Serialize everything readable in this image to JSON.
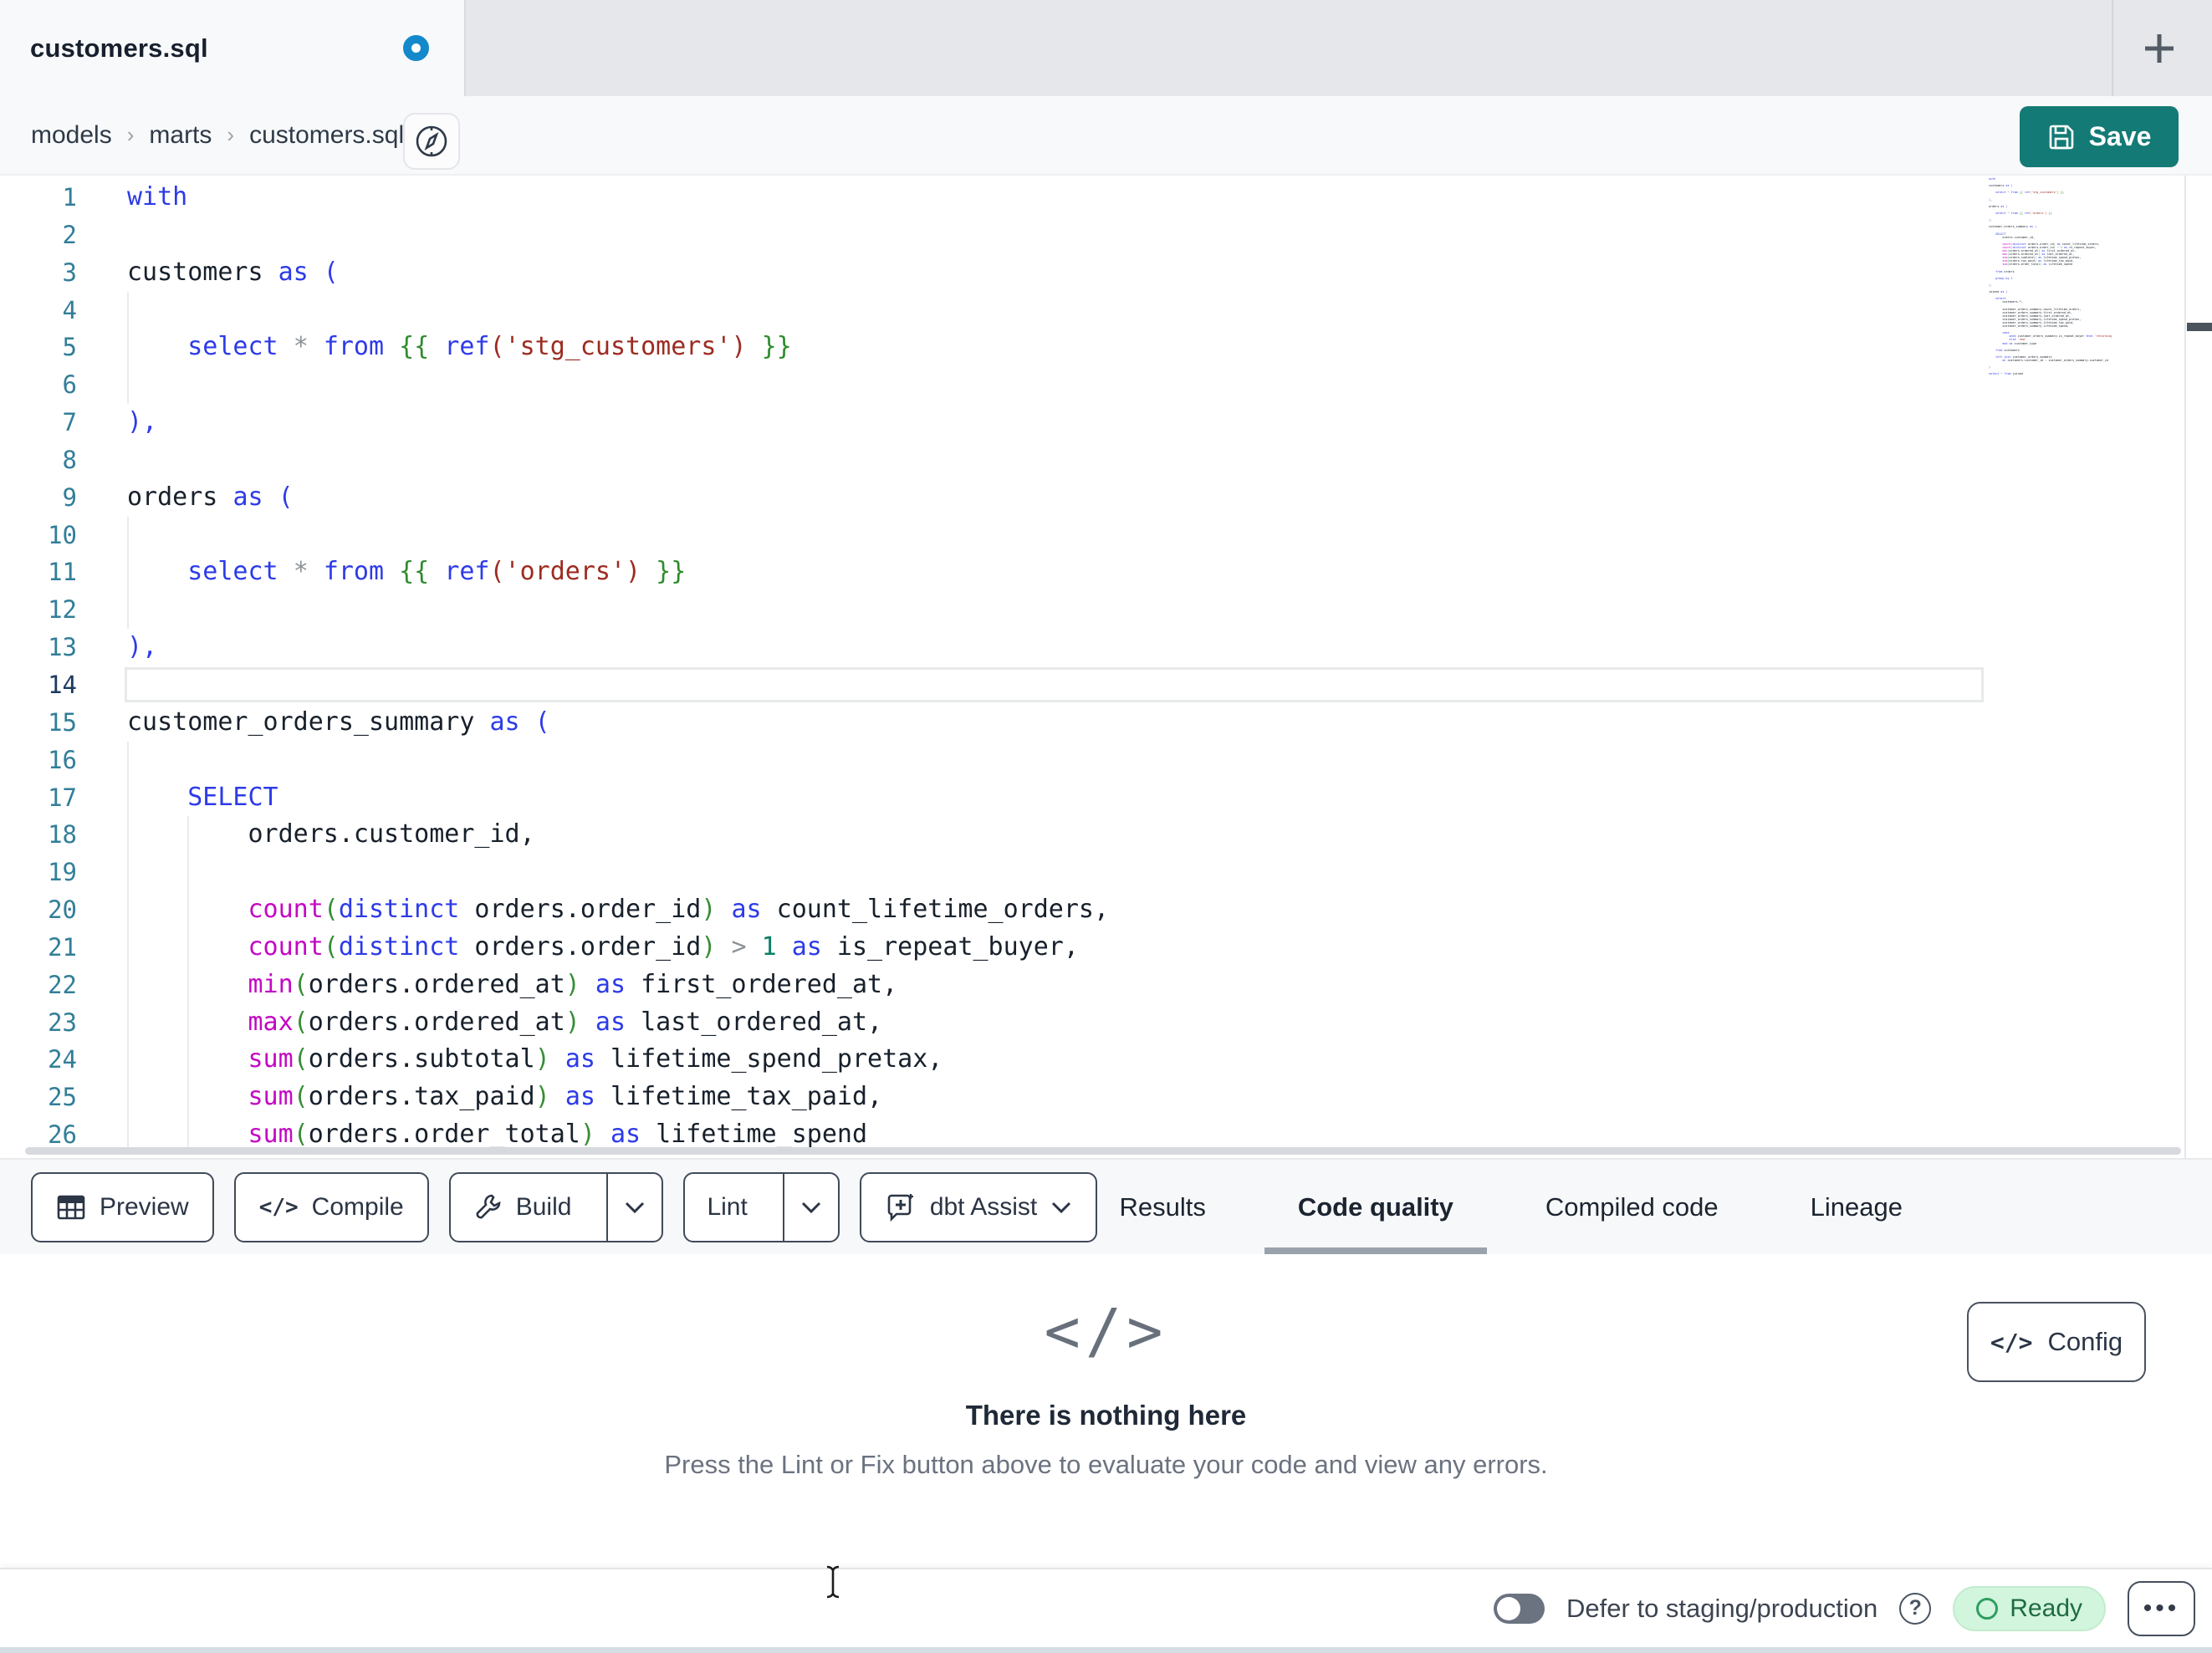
{
  "window": {
    "active_tab_title": "customers.sql",
    "has_unsaved_changes": true
  },
  "breadcrumb": {
    "items": [
      "models",
      "marts",
      "customers.sql"
    ],
    "separator": "›"
  },
  "header": {
    "save_label": "Save"
  },
  "icons": {
    "plus": "+",
    "help": "?",
    "ellipsis": "•••",
    "compile_glyph": "</>",
    "config_glyph": "</>",
    "empty_state_glyph": "</>"
  },
  "colors": {
    "accent_teal": "#147a76",
    "unsaved_dot_blue": "#1389cb",
    "tabbar_gray": "#e5e7ea",
    "active_tab_underline": "#9aa2ac",
    "ready_bg": "#d2f5dd",
    "ready_green": "#2f9e5f",
    "token_kw": "#2d3be8",
    "token_fn": "#c408c4",
    "token_str": "#9c2b20",
    "token_jinja": "#2f8b2f",
    "token_paren": "#368d36",
    "token_num": "#0c7f68",
    "token_op": "#8b9299",
    "token_txt": "#17202b"
  },
  "editor": {
    "active_line": 14,
    "guides": {
      "4": [
        0
      ],
      "5": [
        0
      ],
      "6": [
        0
      ],
      "10": [
        0
      ],
      "11": [
        0
      ],
      "12": [
        0
      ],
      "16": [
        0
      ],
      "17": [
        0
      ],
      "18": [
        0,
        4
      ],
      "19": [
        0,
        4
      ],
      "20": [
        0,
        4
      ],
      "21": [
        0,
        4
      ],
      "22": [
        0,
        4
      ],
      "23": [
        0,
        4
      ],
      "24": [
        0,
        4
      ],
      "25": [
        0,
        4
      ],
      "26": [
        0,
        4
      ]
    },
    "lines": [
      {
        "n": 1,
        "tokens": [
          [
            "kw",
            "with"
          ]
        ]
      },
      {
        "n": 2,
        "tokens": []
      },
      {
        "n": 3,
        "tokens": [
          [
            "txt",
            "customers "
          ],
          [
            "kw",
            "as ("
          ]
        ]
      },
      {
        "n": 4,
        "tokens": []
      },
      {
        "n": 5,
        "tokens": [
          [
            "txt",
            "    "
          ],
          [
            "kw",
            "select"
          ],
          [
            "txt",
            " "
          ],
          [
            "op",
            "*"
          ],
          [
            "txt",
            " "
          ],
          [
            "kw",
            "from"
          ],
          [
            "txt",
            " "
          ],
          [
            "jinja",
            "{{ "
          ],
          [
            "kw",
            "ref"
          ],
          [
            "str",
            "('stg_customers')"
          ],
          [
            "jinja",
            " }}"
          ]
        ]
      },
      {
        "n": 6,
        "tokens": []
      },
      {
        "n": 7,
        "tokens": [
          [
            "kw",
            "),"
          ]
        ]
      },
      {
        "n": 8,
        "tokens": []
      },
      {
        "n": 9,
        "tokens": [
          [
            "txt",
            "orders "
          ],
          [
            "kw",
            "as ("
          ]
        ]
      },
      {
        "n": 10,
        "tokens": []
      },
      {
        "n": 11,
        "tokens": [
          [
            "txt",
            "    "
          ],
          [
            "kw",
            "select"
          ],
          [
            "txt",
            " "
          ],
          [
            "op",
            "*"
          ],
          [
            "txt",
            " "
          ],
          [
            "kw",
            "from"
          ],
          [
            "txt",
            " "
          ],
          [
            "jinja",
            "{{ "
          ],
          [
            "kw",
            "ref"
          ],
          [
            "str",
            "('orders')"
          ],
          [
            "jinja",
            " }}"
          ]
        ]
      },
      {
        "n": 12,
        "tokens": []
      },
      {
        "n": 13,
        "tokens": [
          [
            "kw",
            "),"
          ]
        ]
      },
      {
        "n": 14,
        "tokens": []
      },
      {
        "n": 15,
        "tokens": [
          [
            "txt",
            "customer_orders_summary "
          ],
          [
            "kw",
            "as ("
          ]
        ]
      },
      {
        "n": 16,
        "tokens": []
      },
      {
        "n": 17,
        "tokens": [
          [
            "txt",
            "    "
          ],
          [
            "kw",
            "SELECT"
          ]
        ]
      },
      {
        "n": 18,
        "tokens": [
          [
            "txt",
            "        orders.customer_id,"
          ]
        ]
      },
      {
        "n": 19,
        "tokens": []
      },
      {
        "n": 20,
        "tokens": [
          [
            "txt",
            "        "
          ],
          [
            "fn",
            "count"
          ],
          [
            "paren",
            "("
          ],
          [
            "kw",
            "distinct"
          ],
          [
            "txt",
            " orders.order_id"
          ],
          [
            "paren",
            ")"
          ],
          [
            "txt",
            " "
          ],
          [
            "kw",
            "as"
          ],
          [
            "txt",
            " count_lifetime_orders,"
          ]
        ]
      },
      {
        "n": 21,
        "tokens": [
          [
            "txt",
            "        "
          ],
          [
            "fn",
            "count"
          ],
          [
            "paren",
            "("
          ],
          [
            "kw",
            "distinct"
          ],
          [
            "txt",
            " orders.order_id"
          ],
          [
            "paren",
            ")"
          ],
          [
            "txt",
            " "
          ],
          [
            "op",
            ">"
          ],
          [
            "txt",
            " "
          ],
          [
            "num",
            "1"
          ],
          [
            "txt",
            " "
          ],
          [
            "kw",
            "as"
          ],
          [
            "txt",
            " is_repeat_buyer,"
          ]
        ]
      },
      {
        "n": 22,
        "tokens": [
          [
            "txt",
            "        "
          ],
          [
            "fn",
            "min"
          ],
          [
            "paren",
            "("
          ],
          [
            "txt",
            "orders.ordered_at"
          ],
          [
            "paren",
            ")"
          ],
          [
            "txt",
            " "
          ],
          [
            "kw",
            "as"
          ],
          [
            "txt",
            " first_ordered_at,"
          ]
        ]
      },
      {
        "n": 23,
        "tokens": [
          [
            "txt",
            "        "
          ],
          [
            "fn",
            "max"
          ],
          [
            "paren",
            "("
          ],
          [
            "txt",
            "orders.ordered_at"
          ],
          [
            "paren",
            ")"
          ],
          [
            "txt",
            " "
          ],
          [
            "kw",
            "as"
          ],
          [
            "txt",
            " last_ordered_at,"
          ]
        ]
      },
      {
        "n": 24,
        "tokens": [
          [
            "txt",
            "        "
          ],
          [
            "fn",
            "sum"
          ],
          [
            "paren",
            "("
          ],
          [
            "txt",
            "orders.subtotal"
          ],
          [
            "paren",
            ")"
          ],
          [
            "txt",
            " "
          ],
          [
            "kw",
            "as"
          ],
          [
            "txt",
            " lifetime_spend_pretax,"
          ]
        ]
      },
      {
        "n": 25,
        "tokens": [
          [
            "txt",
            "        "
          ],
          [
            "fn",
            "sum"
          ],
          [
            "paren",
            "("
          ],
          [
            "txt",
            "orders.tax_paid"
          ],
          [
            "paren",
            ")"
          ],
          [
            "txt",
            " "
          ],
          [
            "kw",
            "as"
          ],
          [
            "txt",
            " lifetime_tax_paid,"
          ]
        ]
      },
      {
        "n": 26,
        "tokens": [
          [
            "txt",
            "        "
          ],
          [
            "fn",
            "sum"
          ],
          [
            "paren",
            "("
          ],
          [
            "txt",
            "orders.order_total"
          ],
          [
            "paren",
            ")"
          ],
          [
            "txt",
            " "
          ],
          [
            "kw",
            "as"
          ],
          [
            "txt",
            " lifetime_spend"
          ]
        ]
      }
    ]
  },
  "minimap_extra_lines": [
    {
      "tokens": []
    },
    {
      "tokens": [
        [
          "kw",
          "    from"
        ],
        [
          "txt",
          " orders"
        ]
      ]
    },
    {
      "tokens": []
    },
    {
      "tokens": [
        [
          "kw",
          "    group by"
        ],
        [
          "txt",
          " "
        ],
        [
          "num",
          "1"
        ]
      ]
    },
    {
      "tokens": []
    },
    {
      "tokens": [
        [
          "kw",
          "),"
        ]
      ]
    },
    {
      "tokens": []
    },
    {
      "tokens": [
        [
          "txt",
          "joined "
        ],
        [
          "kw",
          "as ("
        ]
      ]
    },
    {
      "tokens": []
    },
    {
      "tokens": [
        [
          "txt",
          "    "
        ],
        [
          "kw",
          "select"
        ]
      ]
    },
    {
      "tokens": [
        [
          "txt",
          "        customers.*,"
        ]
      ]
    },
    {
      "tokens": []
    },
    {
      "tokens": [
        [
          "txt",
          "        customer_orders_summary.count_lifetime_orders,"
        ]
      ]
    },
    {
      "tokens": [
        [
          "txt",
          "        customer_orders_summary.first_ordered_at,"
        ]
      ]
    },
    {
      "tokens": [
        [
          "txt",
          "        customer_orders_summary.last_ordered_at,"
        ]
      ]
    },
    {
      "tokens": [
        [
          "txt",
          "        customer_orders_summary.lifetime_spend_pretax,"
        ]
      ]
    },
    {
      "tokens": [
        [
          "txt",
          "        customer_orders_summary.lifetime_tax_paid,"
        ]
      ]
    },
    {
      "tokens": [
        [
          "txt",
          "        customer_orders_summary.lifetime_spend,"
        ]
      ]
    },
    {
      "tokens": []
    },
    {
      "tokens": [
        [
          "txt",
          "        "
        ],
        [
          "kw",
          "case"
        ]
      ]
    },
    {
      "tokens": [
        [
          "txt",
          "            "
        ],
        [
          "kw",
          "when"
        ],
        [
          "txt",
          " customer_orders_summary.is_repeat_buyer "
        ],
        [
          "kw",
          "then"
        ],
        [
          "str",
          " 'returning'"
        ]
      ]
    },
    {
      "tokens": [
        [
          "txt",
          "            "
        ],
        [
          "kw",
          "else"
        ],
        [
          "str",
          " 'new'"
        ]
      ]
    },
    {
      "tokens": [
        [
          "txt",
          "        "
        ],
        [
          "kw",
          "end as"
        ],
        [
          "txt",
          " customer_type"
        ]
      ]
    },
    {
      "tokens": []
    },
    {
      "tokens": [
        [
          "kw",
          "    from"
        ],
        [
          "txt",
          " customers"
        ]
      ]
    },
    {
      "tokens": []
    },
    {
      "tokens": [
        [
          "kw",
          "    left join"
        ],
        [
          "txt",
          " customer_orders_summary"
        ]
      ]
    },
    {
      "tokens": [
        [
          "txt",
          "        "
        ],
        [
          "kw",
          "on"
        ],
        [
          "txt",
          " customers.customer_id "
        ],
        [
          "op",
          "="
        ],
        [
          "txt",
          " customer_orders_summary.customer_id"
        ]
      ]
    },
    {
      "tokens": []
    },
    {
      "tokens": [
        [
          "kw",
          ")"
        ]
      ]
    },
    {
      "tokens": []
    },
    {
      "tokens": [
        [
          "kw",
          "select"
        ],
        [
          "txt",
          " "
        ],
        [
          "op",
          "*"
        ],
        [
          "txt",
          " "
        ],
        [
          "kw",
          "from"
        ],
        [
          "txt",
          " joined"
        ]
      ]
    }
  ],
  "toolbar": {
    "preview_label": "Preview",
    "compile_label": "Compile",
    "build_label": "Build",
    "lint_label": "Lint",
    "assist_label": "dbt Assist"
  },
  "panel_tabs": [
    {
      "label": "Results",
      "active": false
    },
    {
      "label": "Code quality",
      "active": true
    },
    {
      "label": "Compiled code",
      "active": false
    },
    {
      "label": "Lineage",
      "active": false
    }
  ],
  "results_panel": {
    "empty_title": "There is nothing here",
    "empty_subtitle": "Press the Lint or Fix button above to evaluate your code and view any errors.",
    "config_label": "Config"
  },
  "status_bar": {
    "defer_label": "Defer to staging/production",
    "ready_label": "Ready",
    "defer_toggle_on": false
  }
}
